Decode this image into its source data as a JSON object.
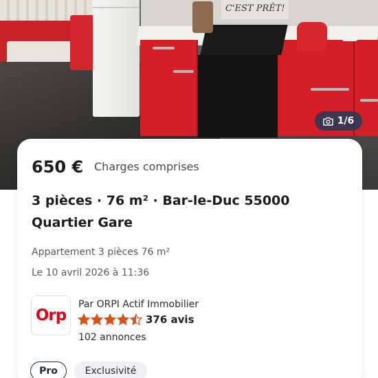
{
  "photo": {
    "sign_text": "C'EST PRÊT!",
    "counter": "1/6",
    "counter_icon": "camera-icon"
  },
  "listing": {
    "price": "650 €",
    "charges": "Charges comprises",
    "title_line1": "3 pièces · 76 m² · Bar-le-Duc 55000",
    "title_line2": "Quartier Gare",
    "property_type": "Appartement 3 pièces 76 m²",
    "date": "Le 10 avril 2026 à 11:36"
  },
  "agency": {
    "logo_text": "Orp",
    "name": "Par ORPI Actif Immobilier",
    "rating": 4.5,
    "rating_max": 5,
    "reviews": "376 avis",
    "listings": "102 annonces",
    "brand_color": "#e2001a",
    "star_color": "#d4541c"
  },
  "tags": {
    "pro": "Pro",
    "exclusive": "Exclusivité"
  }
}
